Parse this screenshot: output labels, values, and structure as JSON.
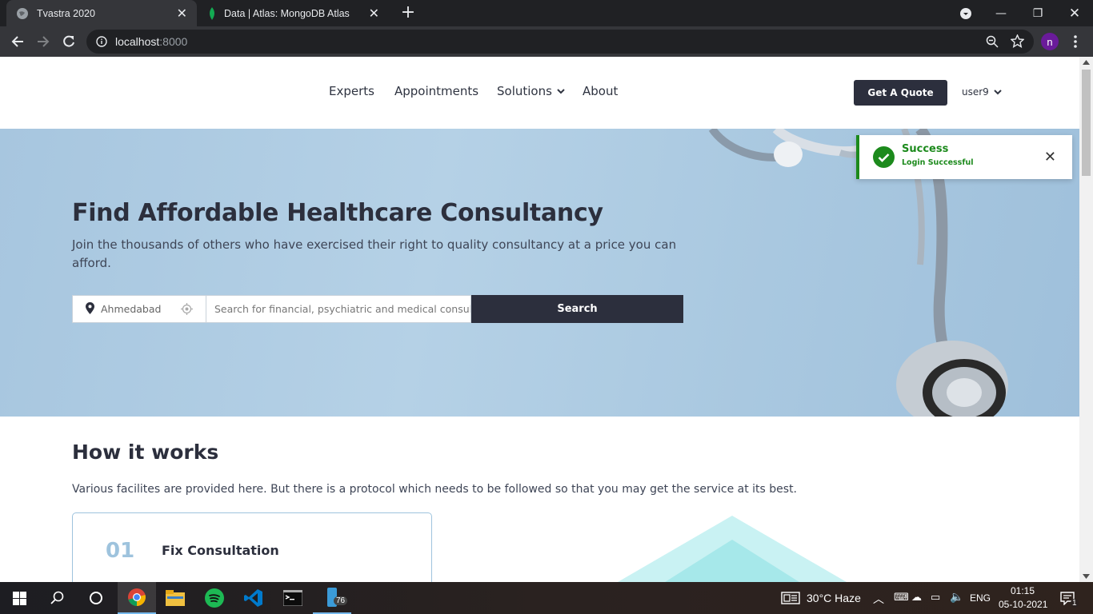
{
  "browser": {
    "tabs": [
      {
        "title": "Tvastra 2020",
        "active": true
      },
      {
        "title": "Data | Atlas: MongoDB Atlas",
        "active": false
      }
    ],
    "url_host": "localhost",
    "url_port": ":8000",
    "profile_initial": "n"
  },
  "nav": {
    "links": [
      "Experts",
      "Appointments",
      "Solutions",
      "About"
    ],
    "quote_button": "Get A Quote",
    "user": "user9"
  },
  "hero": {
    "title": "Find Affordable Healthcare Consultancy",
    "subtitle": "Join the thousands of others who have exercised their right to quality consultancy at a price you can afford.",
    "location_value": "Ahmedabad",
    "search_placeholder": "Search for financial, psychiatric and medical consultants",
    "search_button": "Search"
  },
  "toast": {
    "title": "Success",
    "message": "Login Successful"
  },
  "how": {
    "title": "How it works",
    "description": "Various facilites are provided here. But there is a protocol which needs to be followed so that you may get the service at its best.",
    "steps": [
      {
        "number": "01",
        "title": "Fix Consultation"
      }
    ]
  },
  "taskbar": {
    "weather": "30°C  Haze",
    "language": "ENG",
    "time": "01:15",
    "date": "05-10-2021",
    "badge_count": "76",
    "notification_count": "1"
  },
  "colors": {
    "brand_dark": "#2c2f3d",
    "success": "#1c8a1c",
    "hero_bg": "#a7c6df"
  }
}
